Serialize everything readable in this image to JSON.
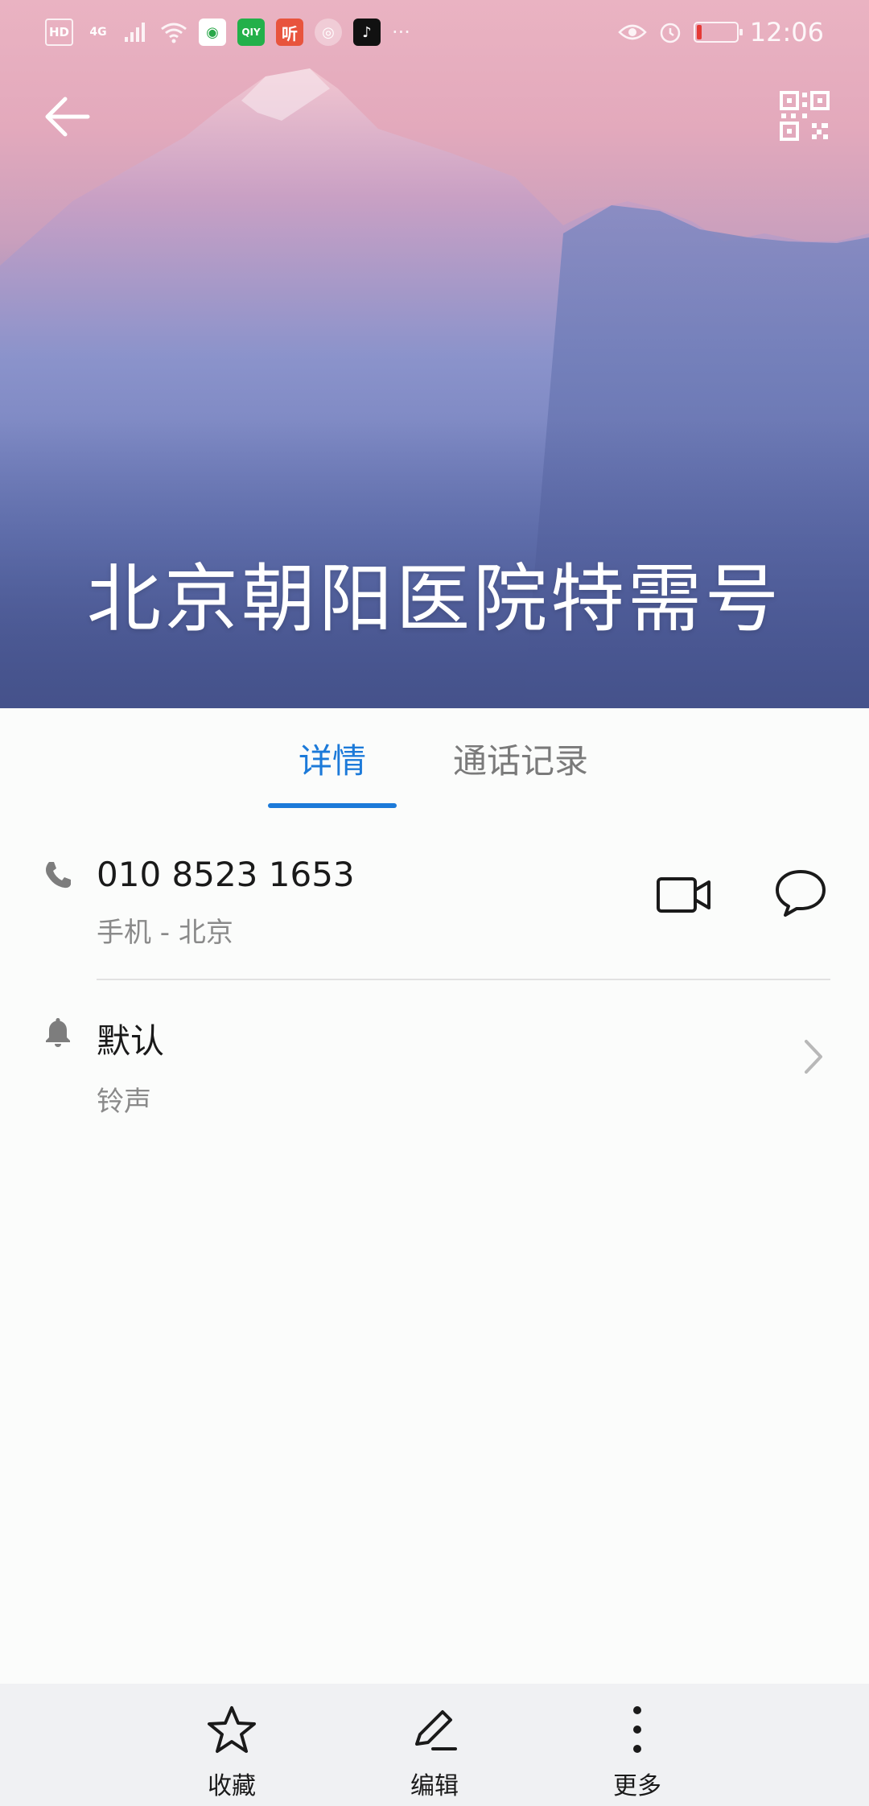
{
  "status_bar": {
    "network_hd": "HD",
    "network_type": "4G",
    "more_indicator": "···",
    "time": "12:06",
    "battery_level_pct": 12,
    "app_icons": [
      "browser-app-icon",
      "iqiyi-app-icon",
      "ting-app-icon",
      "weibo-app-icon",
      "tiktok-app-icon"
    ],
    "app_labels": {
      "iqiyi": "QIY",
      "ting": "听"
    }
  },
  "header": {
    "contact_name": "北京朝阳医院特需号",
    "back_icon": "arrow-left-icon",
    "qr_icon": "qr-code-icon"
  },
  "tabs": [
    {
      "label": "详情",
      "active": true
    },
    {
      "label": "通话记录",
      "active": false
    }
  ],
  "phone_entry": {
    "number": "010 8523 1653",
    "type_location": "手机 - 北京",
    "icon": "phone-icon",
    "actions": [
      "video-call-icon",
      "message-icon"
    ]
  },
  "ringtone_entry": {
    "value": "默认",
    "label": "铃声",
    "icon": "bell-icon"
  },
  "bottom_bar": {
    "items": [
      {
        "label": "收藏",
        "icon": "star-icon"
      },
      {
        "label": "编辑",
        "icon": "edit-icon"
      },
      {
        "label": "更多",
        "icon": "more-vertical-icon"
      }
    ]
  },
  "colors": {
    "accent": "#1c7ad9",
    "hero_top": "#eab3c2",
    "hero_bottom": "#46538c"
  }
}
